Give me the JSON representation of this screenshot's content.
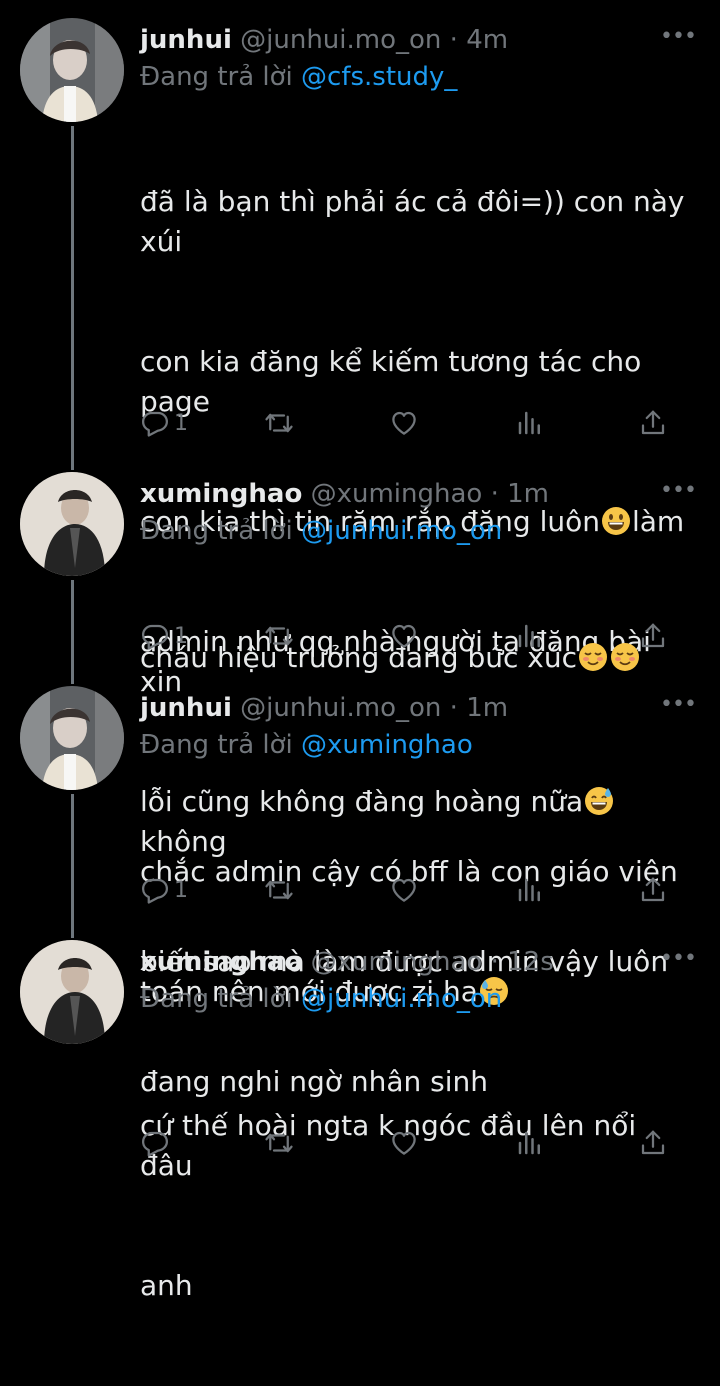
{
  "reply_prefix": "Đang trả lời",
  "colors": {
    "background": "#000000",
    "text": "#e7e9ea",
    "secondary": "#71767b",
    "link": "#1d9bf0",
    "thread_line": "#6e767d"
  },
  "tweets": [
    {
      "name": "junhui",
      "handle": "@junhui.mo_on",
      "time": "4m",
      "reply_to": "@cfs.study_",
      "lines": [
        "đã là bạn thì phải ác cả đôi=)) con này xúi",
        "con kia đăng kể kiếm tương tác cho page",
        "con kia thì tin răm rắp đăng luôn",
        "admin như qq nhà người ta đăng bài xin",
        "lỗi cũng không đàng hoàng nữa",
        "biết sao mà làm được admin vậy luôn",
        "đang nghi ngờ nhân sinh"
      ],
      "line3_after_emoji": "làm",
      "line5_after_emoji": " không",
      "replies": "1",
      "avatar_icon": "avatar-photo"
    },
    {
      "name": "xuminghao",
      "handle": "@xuminghao",
      "time": "1m",
      "reply_to": "@junhui.mo_on",
      "lines": [
        "cháu hiệu trưởng đang bức xúc"
      ],
      "replies": "1",
      "avatar_icon": "avatar-photo"
    },
    {
      "name": "junhui",
      "handle": "@junhui.mo_on",
      "time": "1m",
      "reply_to": "@xuminghao",
      "lines": [
        "chắc admin cậy có bff là con giáo viên",
        "toán nên mới được zị ha"
      ],
      "replies": "1",
      "avatar_icon": "avatar-photo"
    },
    {
      "name": "xuminghao",
      "handle": "@xuminghao",
      "time": "12s",
      "reply_to": "@junhui.mo_on",
      "lines": [
        "cứ thế hoài ngta k ngóc đầu lên nổi đâu",
        "anh"
      ],
      "replies": "",
      "avatar_icon": "avatar-photo"
    }
  ],
  "action_icons": [
    "reply-icon",
    "retweet-icon",
    "like-icon",
    "views-icon",
    "share-icon"
  ]
}
